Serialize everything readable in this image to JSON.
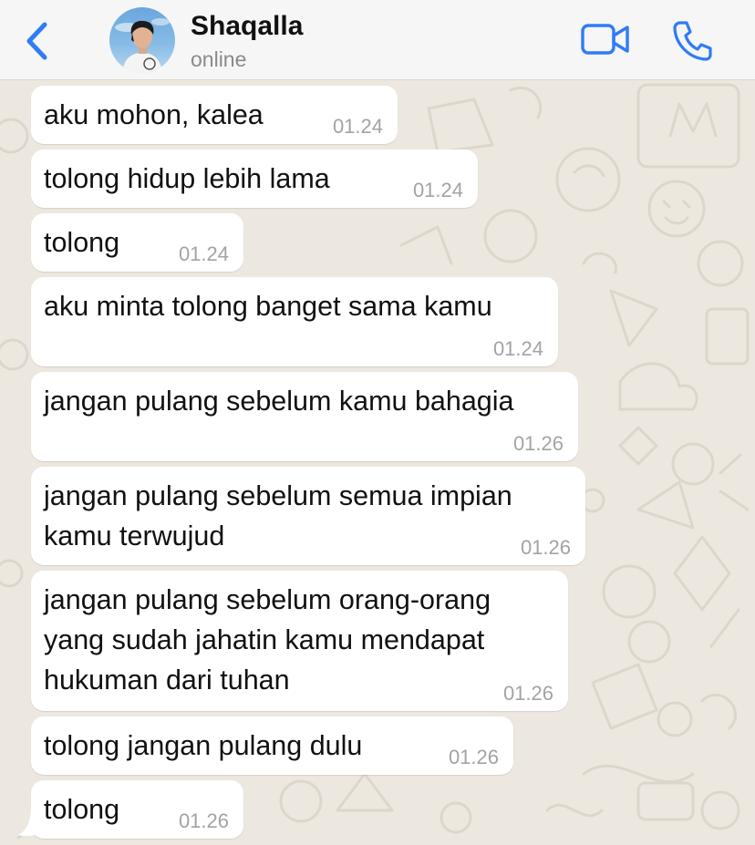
{
  "header": {
    "contact_name": "Shaqalla",
    "status": "online",
    "accent_color": "#2f7cf6",
    "icons": [
      "chevron-left-icon",
      "video-camera-icon",
      "phone-icon"
    ]
  },
  "messages": [
    {
      "text": "aku mohon, kalea",
      "time": "01.24"
    },
    {
      "text": "tolong hidup lebih lama",
      "time": "01.24"
    },
    {
      "text": "tolong",
      "time": "01.24"
    },
    {
      "text": "aku minta tolong banget sama kamu",
      "time": "01.24"
    },
    {
      "text": "jangan pulang sebelum kamu bahagia",
      "time": "01.26"
    },
    {
      "text": "jangan pulang sebelum semua impian\nkamu terwujud",
      "time": "01.26"
    },
    {
      "text": "jangan pulang sebelum orang-orang\nyang sudah jahatin kamu mendapat\nhukuman dari tuhan",
      "time": "01.26"
    },
    {
      "text": "tolong jangan pulang dulu",
      "time": "01.26"
    },
    {
      "text": "tolong",
      "time": "01.26"
    }
  ],
  "colors": {
    "wallpaper": "#ece8e0",
    "bubble": "#ffffff",
    "time_text": "#a3a3a3"
  }
}
